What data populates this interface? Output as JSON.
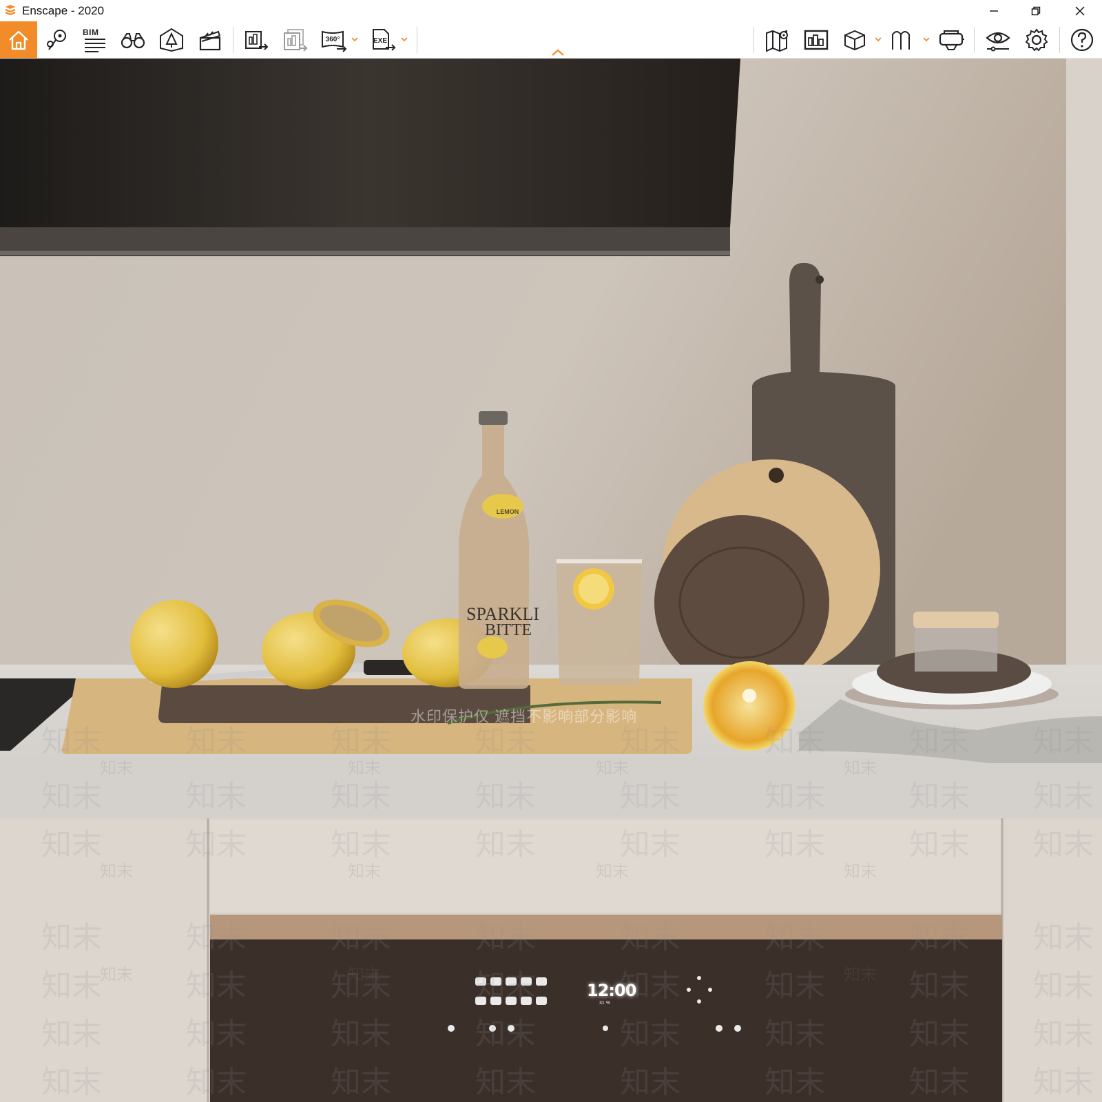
{
  "window": {
    "title": "Enscape - 2020",
    "controls": [
      "minimize",
      "restore",
      "close"
    ]
  },
  "toolbar": {
    "accent_color": "#f28c28",
    "bim_label": "BIM",
    "left_group": [
      {
        "icon": "home-icon",
        "active": true
      },
      {
        "icon": "map-pin-view-icon"
      },
      {
        "icon": "bim-info-icon"
      },
      {
        "icon": "binoculars-icon"
      },
      {
        "icon": "ground-asset-icon"
      },
      {
        "icon": "clapperboard-icon"
      }
    ],
    "export_group": [
      {
        "icon": "render-export-icon"
      },
      {
        "icon": "batch-render-export-icon"
      },
      {
        "icon": "panorama-360-export-icon",
        "label": "360°",
        "has_dropdown": true
      },
      {
        "icon": "exe-export-icon",
        "label": "EXE",
        "has_dropdown": true
      }
    ],
    "right_group": [
      {
        "icon": "map-views-icon"
      },
      {
        "icon": "gallery-icon"
      },
      {
        "icon": "box-view-icon",
        "has_dropdown": true
      },
      {
        "icon": "section-view-icon",
        "has_dropdown": true
      },
      {
        "icon": "vr-headset-icon"
      },
      {
        "icon": "visual-settings-eye-icon"
      },
      {
        "icon": "settings-gear-icon"
      },
      {
        "icon": "help-icon"
      }
    ]
  },
  "viewport": {
    "oven_clock": "12:00",
    "oven_clock_sub": "31 %",
    "watermark_line": "水印保护仅 遮挡不影响部分影响",
    "watermark_mark": "知末",
    "bottle_label": [
      "SPARKLI",
      "BITTE"
    ],
    "bottle_tag": "LEMON"
  }
}
